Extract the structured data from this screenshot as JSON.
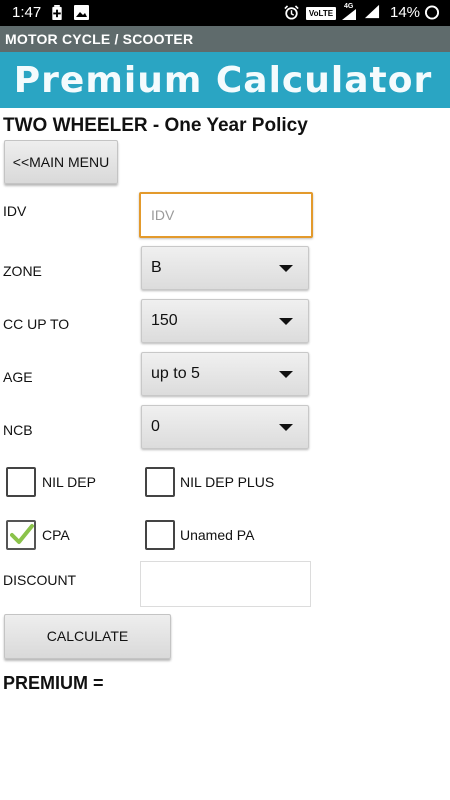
{
  "status_bar": {
    "time": "1:47",
    "battery_percent": "14%",
    "icons": [
      "battery-saver-icon",
      "gallery-icon",
      "alarm-icon",
      "volte-icon",
      "signal-4g-icon",
      "signal-icon",
      "battery-icon"
    ],
    "volte_text": "VoLTE",
    "network_text": "4G"
  },
  "action_bar": {
    "title": "MOTOR CYCLE / SCOOTER"
  },
  "banner": {
    "title": "Premium Calculator",
    "color": "#2aa5c3"
  },
  "heading": "TWO WHEELER - One Year Policy",
  "main_menu_button": "<<MAIN MENU",
  "form": {
    "idv": {
      "label": "IDV",
      "placeholder": "IDV",
      "value": ""
    },
    "zone": {
      "label": "ZONE",
      "value": "B"
    },
    "cc": {
      "label": "CC UP TO",
      "value": "150"
    },
    "age": {
      "label": "AGE",
      "value": "up to 5"
    },
    "ncb": {
      "label": "NCB",
      "value": "0"
    },
    "nil_dep": {
      "label": "NIL DEP",
      "checked": false
    },
    "nil_dep_plus": {
      "label": "NIL DEP PLUS",
      "checked": false
    },
    "cpa": {
      "label": "CPA",
      "checked": true
    },
    "unamed_pa": {
      "label": "Unamed PA",
      "checked": false
    },
    "discount": {
      "label": "DISCOUNT",
      "value": ""
    }
  },
  "calculate_button": "CALCULATE",
  "premium_label": "PREMIUM =",
  "colors": {
    "accent_focus": "#e39a2c",
    "check": "#8bc34a",
    "action_bar": "#5f6b6c"
  }
}
